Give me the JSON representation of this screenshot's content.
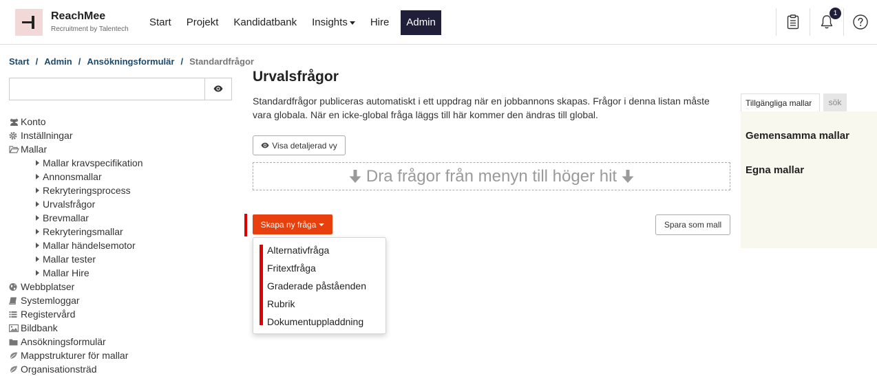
{
  "brand": {
    "name": "ReachMee",
    "subtitle": "Recruitment by Talentech",
    "logo_bg": "#f3d8d8"
  },
  "nav": {
    "items": [
      {
        "label": "Start"
      },
      {
        "label": "Projekt"
      },
      {
        "label": "Kandidatbank"
      },
      {
        "label": "Insights"
      },
      {
        "label": "Hire"
      },
      {
        "label": "Admin"
      }
    ],
    "active": "Admin",
    "active_color": "#1f1f3a"
  },
  "header_icons": {
    "clipboard": "clipboard-icon",
    "notifications": "bell-icon",
    "notification_count": "1",
    "help": "help-icon"
  },
  "breadcrumb": {
    "items": [
      "Start",
      "Admin",
      "Ansökningsformulär",
      "Standardfrågor"
    ],
    "separator": "/"
  },
  "search": {
    "value": "",
    "placeholder": ""
  },
  "tree": {
    "items": [
      {
        "label": "Konto",
        "icon": "users-icon"
      },
      {
        "label": "Inställningar",
        "icon": "gear-icon"
      },
      {
        "label": "Mallar",
        "icon": "folder-open-icon"
      },
      {
        "label": "Mallar kravspecifikation"
      },
      {
        "label": "Annonsmallar"
      },
      {
        "label": "Rekryteringsprocess"
      },
      {
        "label": "Urvalsfrågor"
      },
      {
        "label": "Brevmallar"
      },
      {
        "label": "Rekryteringsmallar"
      },
      {
        "label": "Mallar händelsemotor"
      },
      {
        "label": "Mallar tester"
      },
      {
        "label": "Mallar Hire"
      },
      {
        "label": "Webbplatser",
        "icon": "globe-icon"
      },
      {
        "label": "Systemloggar",
        "icon": "book-icon"
      },
      {
        "label": "Registervård",
        "icon": "list-icon"
      },
      {
        "label": "Bildbank",
        "icon": "image-icon"
      },
      {
        "label": "Ansökningsformulär",
        "icon": "folder-icon"
      },
      {
        "label": "Mappstrukturer för mallar",
        "icon": "leaf-icon"
      },
      {
        "label": "Organisationsträd",
        "icon": "leaf-icon"
      }
    ]
  },
  "main": {
    "title": "Urvalsfrågor",
    "description": "Standardfrågor publiceras automatiskt i ett uppdrag när en jobbannons skapas. Frågor i denna listan måste vara globala. När en icke-global fråga läggs till här kommer den ändras till global.",
    "detail_view_button": "Visa detaljerad vy",
    "dropzone_text": "Dra frågor från menyn till höger hit",
    "create_button": "Skapa ny fråga",
    "create_button_color": "#e8400c",
    "save_template_button": "Spara som mall",
    "marker_color": "#e00000",
    "dropdown_items": [
      "Alternativfråga",
      "Fritextfråga",
      "Graderade påståenden",
      "Rubrik",
      "Dokumentuppladdning"
    ]
  },
  "right_panel": {
    "tabs": [
      "Tillgängliga mallar",
      "sök"
    ],
    "active_tab": "Tillgängliga mallar",
    "headings": [
      "Gemensamma mallar",
      "Egna mallar"
    ],
    "bg": "#f9f8ef"
  }
}
